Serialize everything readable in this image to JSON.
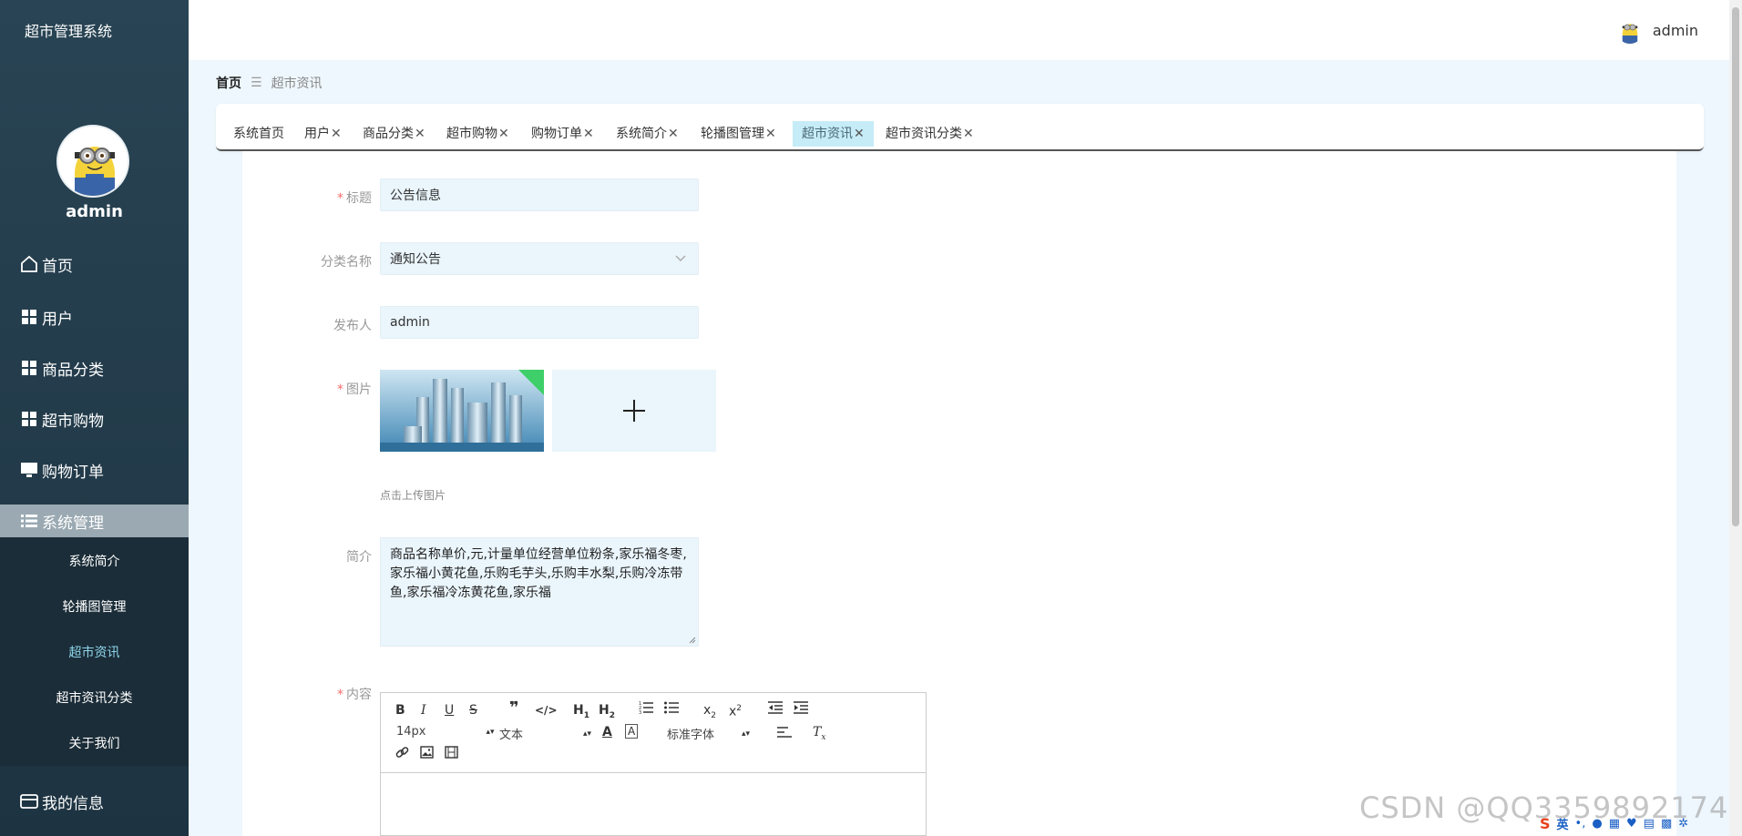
{
  "sidebar": {
    "title": "超市管理系统",
    "username": "admin",
    "menu": [
      {
        "label": "首页",
        "icon": "home-icon"
      },
      {
        "label": "用户",
        "icon": "grid-icon"
      },
      {
        "label": "商品分类",
        "icon": "grid-icon"
      },
      {
        "label": "超市购物",
        "icon": "grid-icon"
      },
      {
        "label": "购物订单",
        "icon": "monitor-icon"
      },
      {
        "label": "系统管理",
        "icon": "list-icon"
      }
    ],
    "submenu": [
      "系统简介",
      "轮播图管理",
      "超市资讯",
      "超市资讯分类",
      "关于我们"
    ],
    "bottom_item": {
      "label": "我的信息",
      "icon": "wallet-icon"
    }
  },
  "topbar": {
    "username": "admin"
  },
  "breadcrumb": {
    "home": "首页",
    "separator": "☰",
    "current": "超市资讯"
  },
  "tabs": [
    {
      "label": "系统首页",
      "closable": false
    },
    {
      "label": "用户",
      "closable": true
    },
    {
      "label": "商品分类",
      "closable": true
    },
    {
      "label": "超市购物",
      "closable": true
    },
    {
      "label": "购物订单",
      "closable": true
    },
    {
      "label": "系统简介",
      "closable": true
    },
    {
      "label": "轮播图管理",
      "closable": true
    },
    {
      "label": "超市资讯",
      "closable": true,
      "active": true
    },
    {
      "label": "超市资讯分类",
      "closable": true
    }
  ],
  "form": {
    "title": {
      "label": "标题",
      "required": true,
      "value": "公告信息"
    },
    "category": {
      "label": "分类名称",
      "required": false,
      "value": "通知公告"
    },
    "publisher": {
      "label": "发布人",
      "required": false,
      "value": "admin"
    },
    "image": {
      "label": "图片",
      "required": true,
      "hint": "点击上传图片"
    },
    "intro": {
      "label": "简介",
      "required": false,
      "value": "商品名称单价,元,计量单位经营单位粉条,家乐福冬枣,家乐福小黄花鱼,乐购毛芋头,乐购丰水梨,乐购冷冻带鱼,家乐福冷冻黄花鱼,家乐福"
    },
    "content": {
      "label": "内容",
      "required": true
    }
  },
  "editor": {
    "font_size": "14px",
    "header_select": "文本",
    "font_family": "标准字体"
  },
  "watermark": "CSDN @QQ3359892174",
  "ime": {
    "lang": "英"
  },
  "colors": {
    "sidebar": "#294454",
    "active_tab": "#c6ecf7",
    "required": "#f56c6c",
    "input_bg": "#eaf5fc"
  }
}
